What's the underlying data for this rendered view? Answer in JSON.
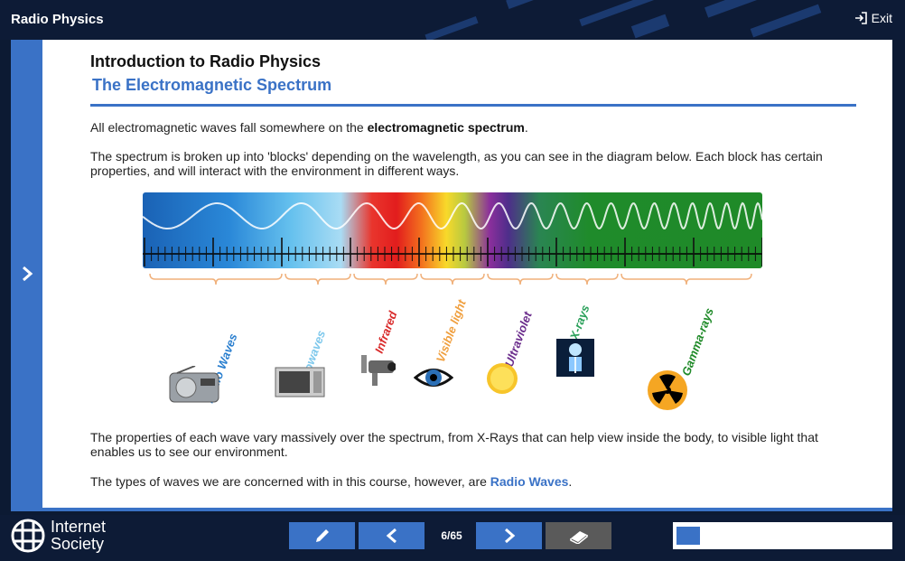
{
  "header": {
    "app_title": "Radio Physics",
    "exit_label": "Exit"
  },
  "content": {
    "course_title": "Introduction to Radio Physics",
    "page_title": "The Electromagnetic Spectrum",
    "para1_pre": "All electromagnetic waves fall somewhere on the ",
    "para1_bold": "electromagnetic spectrum",
    "para1_post": ".",
    "para2": "The spectrum is broken up into 'blocks' depending on the wavelength, as you can see in the diagram below. Each block has certain properties, and will interact with the environment in different ways.",
    "para3": "The properties of each wave vary massively over the spectrum, from X-Rays that can help view inside the body, to visible light that enables us to see our environment.",
    "para4_pre": "The types of waves we are concerned with in this course, however, are ",
    "para4_link": "Radio Waves",
    "para4_post": "."
  },
  "spectrum": {
    "bands": [
      {
        "label": "Radio Waves",
        "color": "#2a7fcf",
        "icon": "radio-icon"
      },
      {
        "label": "Microwaves",
        "color": "#7ec8ec",
        "icon": "microwave-icon"
      },
      {
        "label": "Infrared",
        "color": "#d92b2b",
        "icon": "thermal-camera-icon"
      },
      {
        "label": "Visible light",
        "color": "#f0a040",
        "icon": "eye-icon"
      },
      {
        "label": "Ultraviolet",
        "color": "#6b2d8c",
        "icon": "sun-icon"
      },
      {
        "label": "X-rays",
        "color": "#2aa05a",
        "icon": "xray-skeleton-icon"
      },
      {
        "label": "Gamma-rays",
        "color": "#1f8a28",
        "icon": "radiation-icon"
      }
    ]
  },
  "footer": {
    "logo_line1": "Internet",
    "logo_line2": "Society",
    "page_counter": "6/65",
    "progress_fraction": 0.092,
    "icons": {
      "notes": "pencil-icon",
      "prev": "chevron-left-icon",
      "next": "chevron-right-icon",
      "glossary": "book-icon"
    }
  },
  "colors": {
    "accent": "#3a72c6",
    "dark_bg": "#0d1b36"
  }
}
